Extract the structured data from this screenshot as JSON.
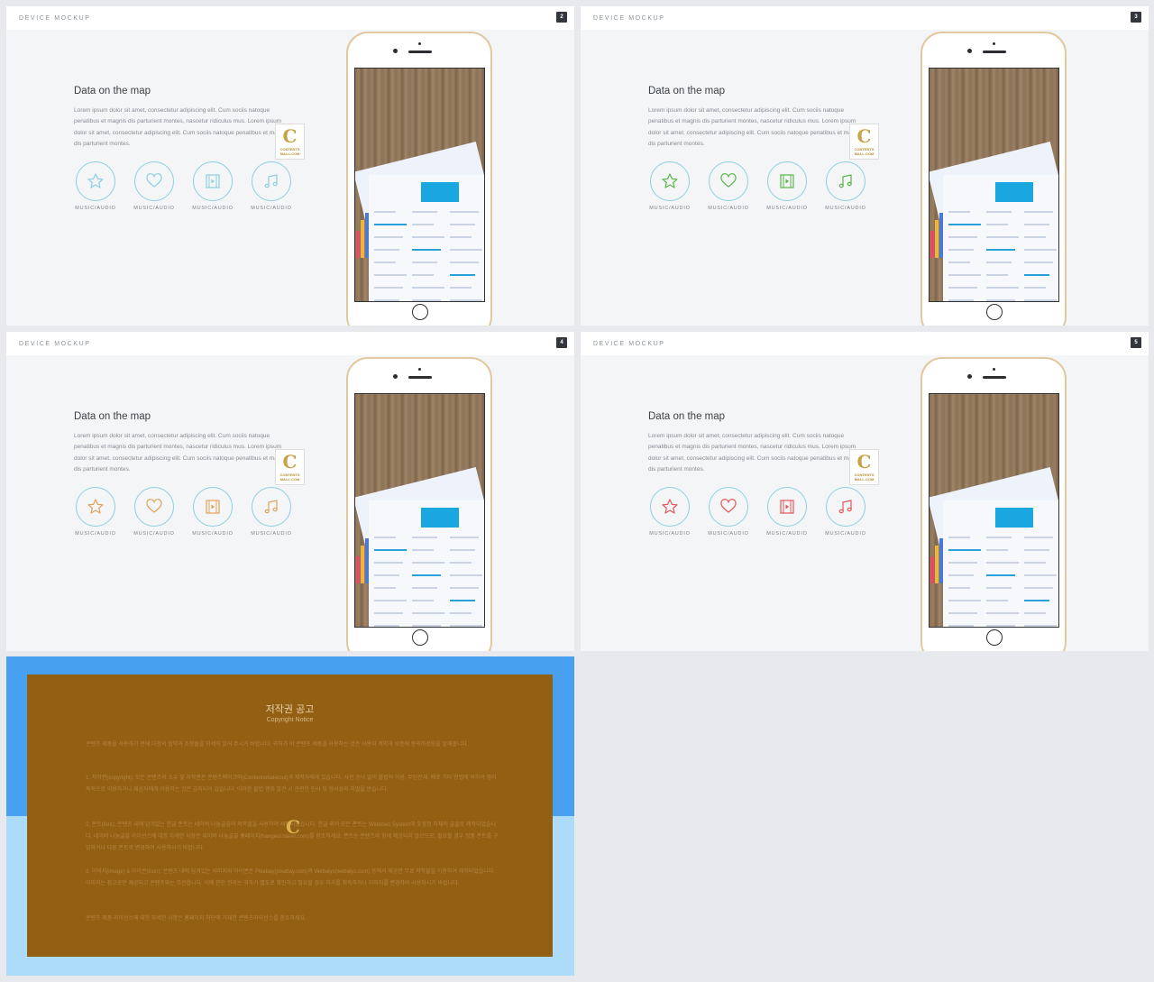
{
  "slides": [
    {
      "header": "DEVICE MOCKUP",
      "number": "2",
      "title": "Data on the map",
      "body": "Lorem ipsum dolor sit amet, consectetur adipiscing elit. Cum sociis natoque penatibus et magnis dis parturient montes, nascetur ridiculus mus. Lorem ipsum dolor sit amet, consectetur adipiscing elit. Cum sociis natoque penatibus et magnis dis parturient montes.",
      "icons": [
        {
          "name": "star-icon",
          "label": "MUSIC/AUDIO",
          "color": "#8ccfe0"
        },
        {
          "name": "heart-icon",
          "label": "MUSIC/AUDIO",
          "color": "#8ccfe0"
        },
        {
          "name": "film-icon",
          "label": "MUSIC/AUDIO",
          "color": "#8ccfe0"
        },
        {
          "name": "music-note-icon",
          "label": "MUSIC/AUDIO",
          "color": "#8ccfe0"
        }
      ]
    },
    {
      "header": "DEVICE MOCKUP",
      "number": "3",
      "title": "Data on the map",
      "body": "Lorem ipsum dolor sit amet, consectetur adipiscing elit. Cum sociis natoque penatibus et magnis dis parturient montes, nascetur ridiculus mus. Lorem ipsum dolor sit amet, consectetur adipiscing elit. Cum sociis natoque penatibus et magnis dis parturient montes.",
      "icons": [
        {
          "name": "star-icon",
          "label": "MUSIC/AUDIO",
          "color": "#5ab64a"
        },
        {
          "name": "heart-icon",
          "label": "MUSIC/AUDIO",
          "color": "#5ab64a"
        },
        {
          "name": "film-icon",
          "label": "MUSIC/AUDIO",
          "color": "#5ab64a"
        },
        {
          "name": "music-note-icon",
          "label": "MUSIC/AUDIO",
          "color": "#5ab64a"
        }
      ]
    },
    {
      "header": "DEVICE MOCKUP",
      "number": "4",
      "title": "Data on the map",
      "body": "Lorem ipsum dolor sit amet, consectetur adipiscing elit. Cum sociis natoque penatibus et magnis dis parturient montes, nascetur ridiculus mus. Lorem ipsum dolor sit amet, consectetur adipiscing elit. Cum sociis natoque penatibus et magnis dis parturient montes.",
      "icons": [
        {
          "name": "star-icon",
          "label": "MUSIC/AUDIO",
          "color": "#e0a25a"
        },
        {
          "name": "heart-icon",
          "label": "MUSIC/AUDIO",
          "color": "#e0a25a"
        },
        {
          "name": "film-icon",
          "label": "MUSIC/AUDIO",
          "color": "#e0a25a"
        },
        {
          "name": "music-note-icon",
          "label": "MUSIC/AUDIO",
          "color": "#e0a25a"
        }
      ]
    },
    {
      "header": "DEVICE MOCKUP",
      "number": "5",
      "title": "Data on the map",
      "body": "Lorem ipsum dolor sit amet, consectetur adipiscing elit. Cum sociis natoque penatibus et magnis dis parturient montes, nascetur ridiculus mus. Lorem ipsum dolor sit amet, consectetur adipiscing elit. Cum sociis natoque penatibus et magnis dis parturient montes.",
      "icons": [
        {
          "name": "star-icon",
          "label": "MUSIC/AUDIO",
          "color": "#e0585a"
        },
        {
          "name": "heart-icon",
          "label": "MUSIC/AUDIO",
          "color": "#e0585a"
        },
        {
          "name": "film-icon",
          "label": "MUSIC/AUDIO",
          "color": "#e0585a"
        },
        {
          "name": "music-note-icon",
          "label": "MUSIC/AUDIO",
          "color": "#e0585a"
        }
      ]
    }
  ],
  "watermark": {
    "letter": "C",
    "text": "CONTENTS MALL.COM"
  },
  "notice": {
    "title": "저작권 공고",
    "subtitle": "Copyright Notice",
    "paragraphs": [
      "콘텐츠 제품을 사용하기 전에 다음의 협약과 조항들을 자세히 읽어 주시기 바랍니다. 귀하가 이 콘텐츠 제품을 사용하는 것은 사용자 계약과 보증에 동의하셨음을 말해줍니다.",
      "1. 저작권(copyright): 모든 콘텐츠의 소유 및 저작권은 콘텐츠메이크미(Contentsmakeout)과 제작자에게 있습니다. 사전 승낙 없이 불법적 이용, 무단전재, 배포 기타 방법에 의하여 영리 목적으로 이용하거나 제삼자에게 이용하는 것은 금지되어 있습니다. 이러한 불법 행위 발견 시 관련한 민사 및 형사상의 처벌을 받습니다.",
      "2. 폰트(font): 콘텐츠 내에 담겨있는 한글 폰트는 네이버 나눔글꼴의 저작물을 사용하여 제작되었습니다. 한글 외의 모든 폰트는 Windows System에 포함된 자체의 글꼴로 제작되었습니다. 네이버 나눔글꼴 라이선스에 대한 자세한 사항은 네이버 나눔글꼴 홈페이지(hangeul.naver.com)를 참조하세요. 폰트는 콘텐츠와 함께 제공되지 않으므로, 필요할 경우 정품 폰트를 구입하거나 다른 폰트로 변경하여 사용하시기 바랍니다.",
      "3. 이미지(image) & 아이콘(icon): 콘텐츠 내에 담겨있는 이미지와 아이콘은 Pixabay(pixabay.com)와 Webalys(webalys.com) 등에서 제공한 무료 저작물을 이용하여 제작되었습니다. 이미지는 참고로만 제공되고 콘텐츠와는 무관합니다. 이에 관한 권리는 귀하가 별도로 확인하고 필요할 경우 허가를 취득하거나 이미지를 변경하여 사용하시기 바랍니다.",
      "콘텐츠 제품 라이선스에 대한 자세한 사항은 홈페이지 하단에 기재한 콘텐츠라이선스를 참조하세요."
    ]
  }
}
